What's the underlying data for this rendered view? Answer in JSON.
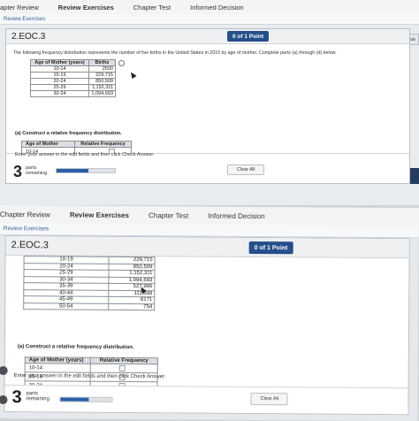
{
  "top": {
    "tabs": [
      "apter Review",
      "Review Exercises",
      "Chapter Test",
      "Informed Decision"
    ],
    "active_tab": 1,
    "subtab": "Review Exercises",
    "question_title": "2.EOC.3",
    "score": "0 of 1 Point",
    "side_button": "Que",
    "intro": "The following frequency distribution represents the number of live births in the United States in 2015 by age of mother. Complete parts (a) through (d) below.",
    "births_table": {
      "headers": [
        "Age of Mother (years)",
        "Births"
      ],
      "rows": [
        [
          "10-14",
          "2500"
        ],
        [
          "15-19",
          "229,715"
        ],
        [
          "20-24",
          "850,509"
        ],
        [
          "25-29",
          "1,152,311"
        ],
        [
          "30-34",
          "1,094,693"
        ]
      ]
    },
    "part_a": "(a) Construct a relative frequency distribution.",
    "rel_table": {
      "headers": [
        "Age of Mother",
        "Relative Frequency"
      ],
      "rows": [
        "10-14",
        "15-19",
        "20-24"
      ]
    },
    "hint": "Enter your answer in the edit fields and then click Check Answer.",
    "parts_count": "3",
    "parts_label_1": "parts",
    "parts_label_2": "remaining",
    "progress": 0.55,
    "clear_label": "Clear All"
  },
  "bottom": {
    "tabs": [
      "Chapter Review",
      "Review Exercises",
      "Chapter Test",
      "Informed Decision"
    ],
    "active_tab": 1,
    "subtab": "Review Exercises",
    "question_title": "2.EOC.3",
    "score": "0 of 1 Point",
    "births_table": {
      "rows": [
        [
          "10-19",
          "229,715"
        ],
        [
          "20-24",
          "850,509"
        ],
        [
          "25-29",
          "1,152,311"
        ],
        [
          "30-34",
          "1,094,693"
        ],
        [
          "35-39",
          "527,996"
        ],
        [
          "40-44",
          "111,848"
        ],
        [
          "45-49",
          "8171"
        ],
        [
          "50-54",
          "754"
        ]
      ]
    },
    "part_a": "(a) Construct a relative frequency distribution.",
    "rel_table": {
      "headers": [
        "Age of Mother (years)",
        "Relative Frequency"
      ],
      "rows": [
        "10-14",
        "15-19",
        "20-24"
      ]
    },
    "hint": "Enter your answer in the edit fields and then click Check Answer.",
    "parts_count": "3",
    "parts_label_1": "parts",
    "parts_label_2": "remaining",
    "progress": 0.55,
    "clear_label": "Clear All"
  }
}
